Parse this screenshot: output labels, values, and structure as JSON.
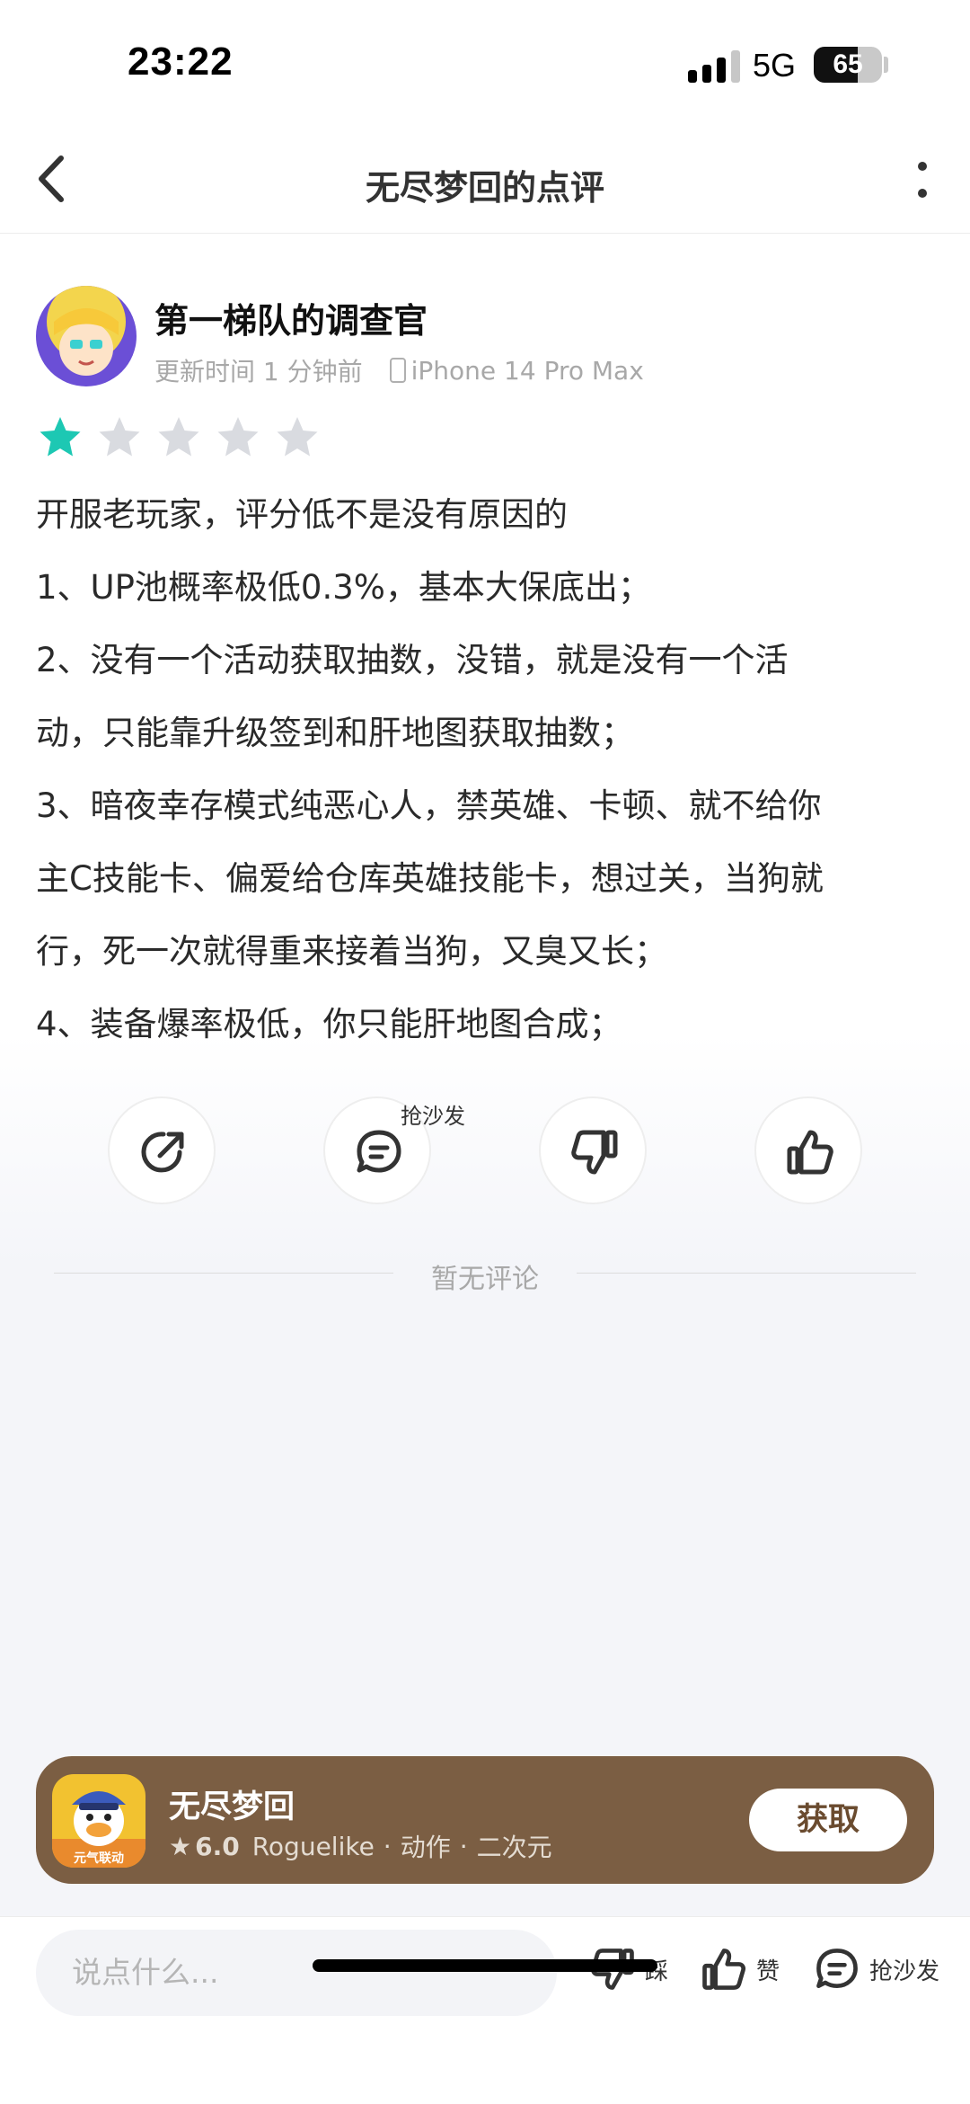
{
  "status_bar": {
    "time": "23:22",
    "network": "5G",
    "battery": "65",
    "battery_level": 0.65
  },
  "nav": {
    "title": "无尽梦回的点评"
  },
  "review": {
    "author": "第一梯队的调查官",
    "updated": "更新时间 1 分钟前",
    "device": "iPhone 14 Pro Max",
    "rating": 1,
    "rating_max": 5,
    "lines": [
      "开服老玩家，评分低不是没有原因的",
      "1、UP池概率极低0.3%，基本大保底出；",
      "2、没有一个活动获取抽数，没错，就是没有一个活",
      "动，只能靠升级签到和肝地图获取抽数；",
      "3、暗夜幸存模式纯恶心人，禁英雄、卡顿、就不给你",
      "主C技能卡、偏爱给仓库英雄技能卡，想过关，当狗就",
      "行，死一次就得重来接着当狗，又臭又长；",
      "4、装备爆率极低，你只能肝地图合成；"
    ]
  },
  "actions": {
    "sofa_tag": "抢沙发"
  },
  "comments": {
    "empty_text": "暂无评论"
  },
  "app_card": {
    "name": "无尽梦回",
    "rating": "6.0",
    "tags": [
      "Roguelike",
      "动作",
      "二次元"
    ],
    "get_label": "获取",
    "icon_badge": "元气联动"
  },
  "bottom_bar": {
    "input_placeholder": "说点什么...",
    "dislike_label": "踩",
    "like_label": "赞",
    "sofa_label": "抢沙发"
  },
  "colors": {
    "accent_star": "#1dc8b3",
    "card_bg": "#7b5e43"
  }
}
